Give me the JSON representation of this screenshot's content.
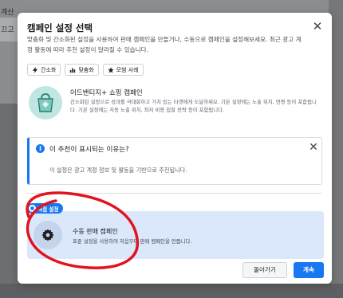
{
  "background": {
    "left_text_1": "계산",
    "left_text_2": "끄고"
  },
  "modal": {
    "title": "캠페인 설정 선택",
    "description": "맞춤화 및 간소화된 설정을 사용하여 판매 캠페인을 만들거나, 수동으로 캠페인을 설정해보세요. 최근 광고 계정 활동에 따라 추천 설정이 달라질 수 있습니다.",
    "chips": [
      {
        "icon": "lightning-icon",
        "label": "간소화"
      },
      {
        "icon": "chart-icon",
        "label": "맞춤화"
      },
      {
        "icon": "star-icon",
        "label": "모범 사례"
      }
    ],
    "recommended": {
      "icon": "shopping-bag-icon",
      "title": "어드밴티지+ 쇼핑 캠페인",
      "description": "간소화된 설정으로 성과를 극대화하고 가치 있는 타겟에게 도달하세요. 기본 설정에는 노출 위치, 연령 등이 포함됩니다. 기본 설정에는 자동 노출 위치, 최저 비용 입찰 전략 등이 포함됩니다."
    },
    "info": {
      "title": "이 추천이 표시되는 이유는?",
      "description": "이 설정은 광고 계정 정보 및 활동을 기반으로 추천됩니다."
    },
    "badge": "직접 설정",
    "manual": {
      "icon": "gear-icon",
      "title": "수동 판매 캠페인",
      "description": "표준 설정을 사용하여 처음부터 판매 캠페인을 만듭니다."
    },
    "buttons": {
      "back": "돌아가기",
      "next": "계속"
    }
  },
  "colors": {
    "accent": "#1877f2",
    "annotation": "#e0141e",
    "manual_card": "#dbe7fa"
  }
}
